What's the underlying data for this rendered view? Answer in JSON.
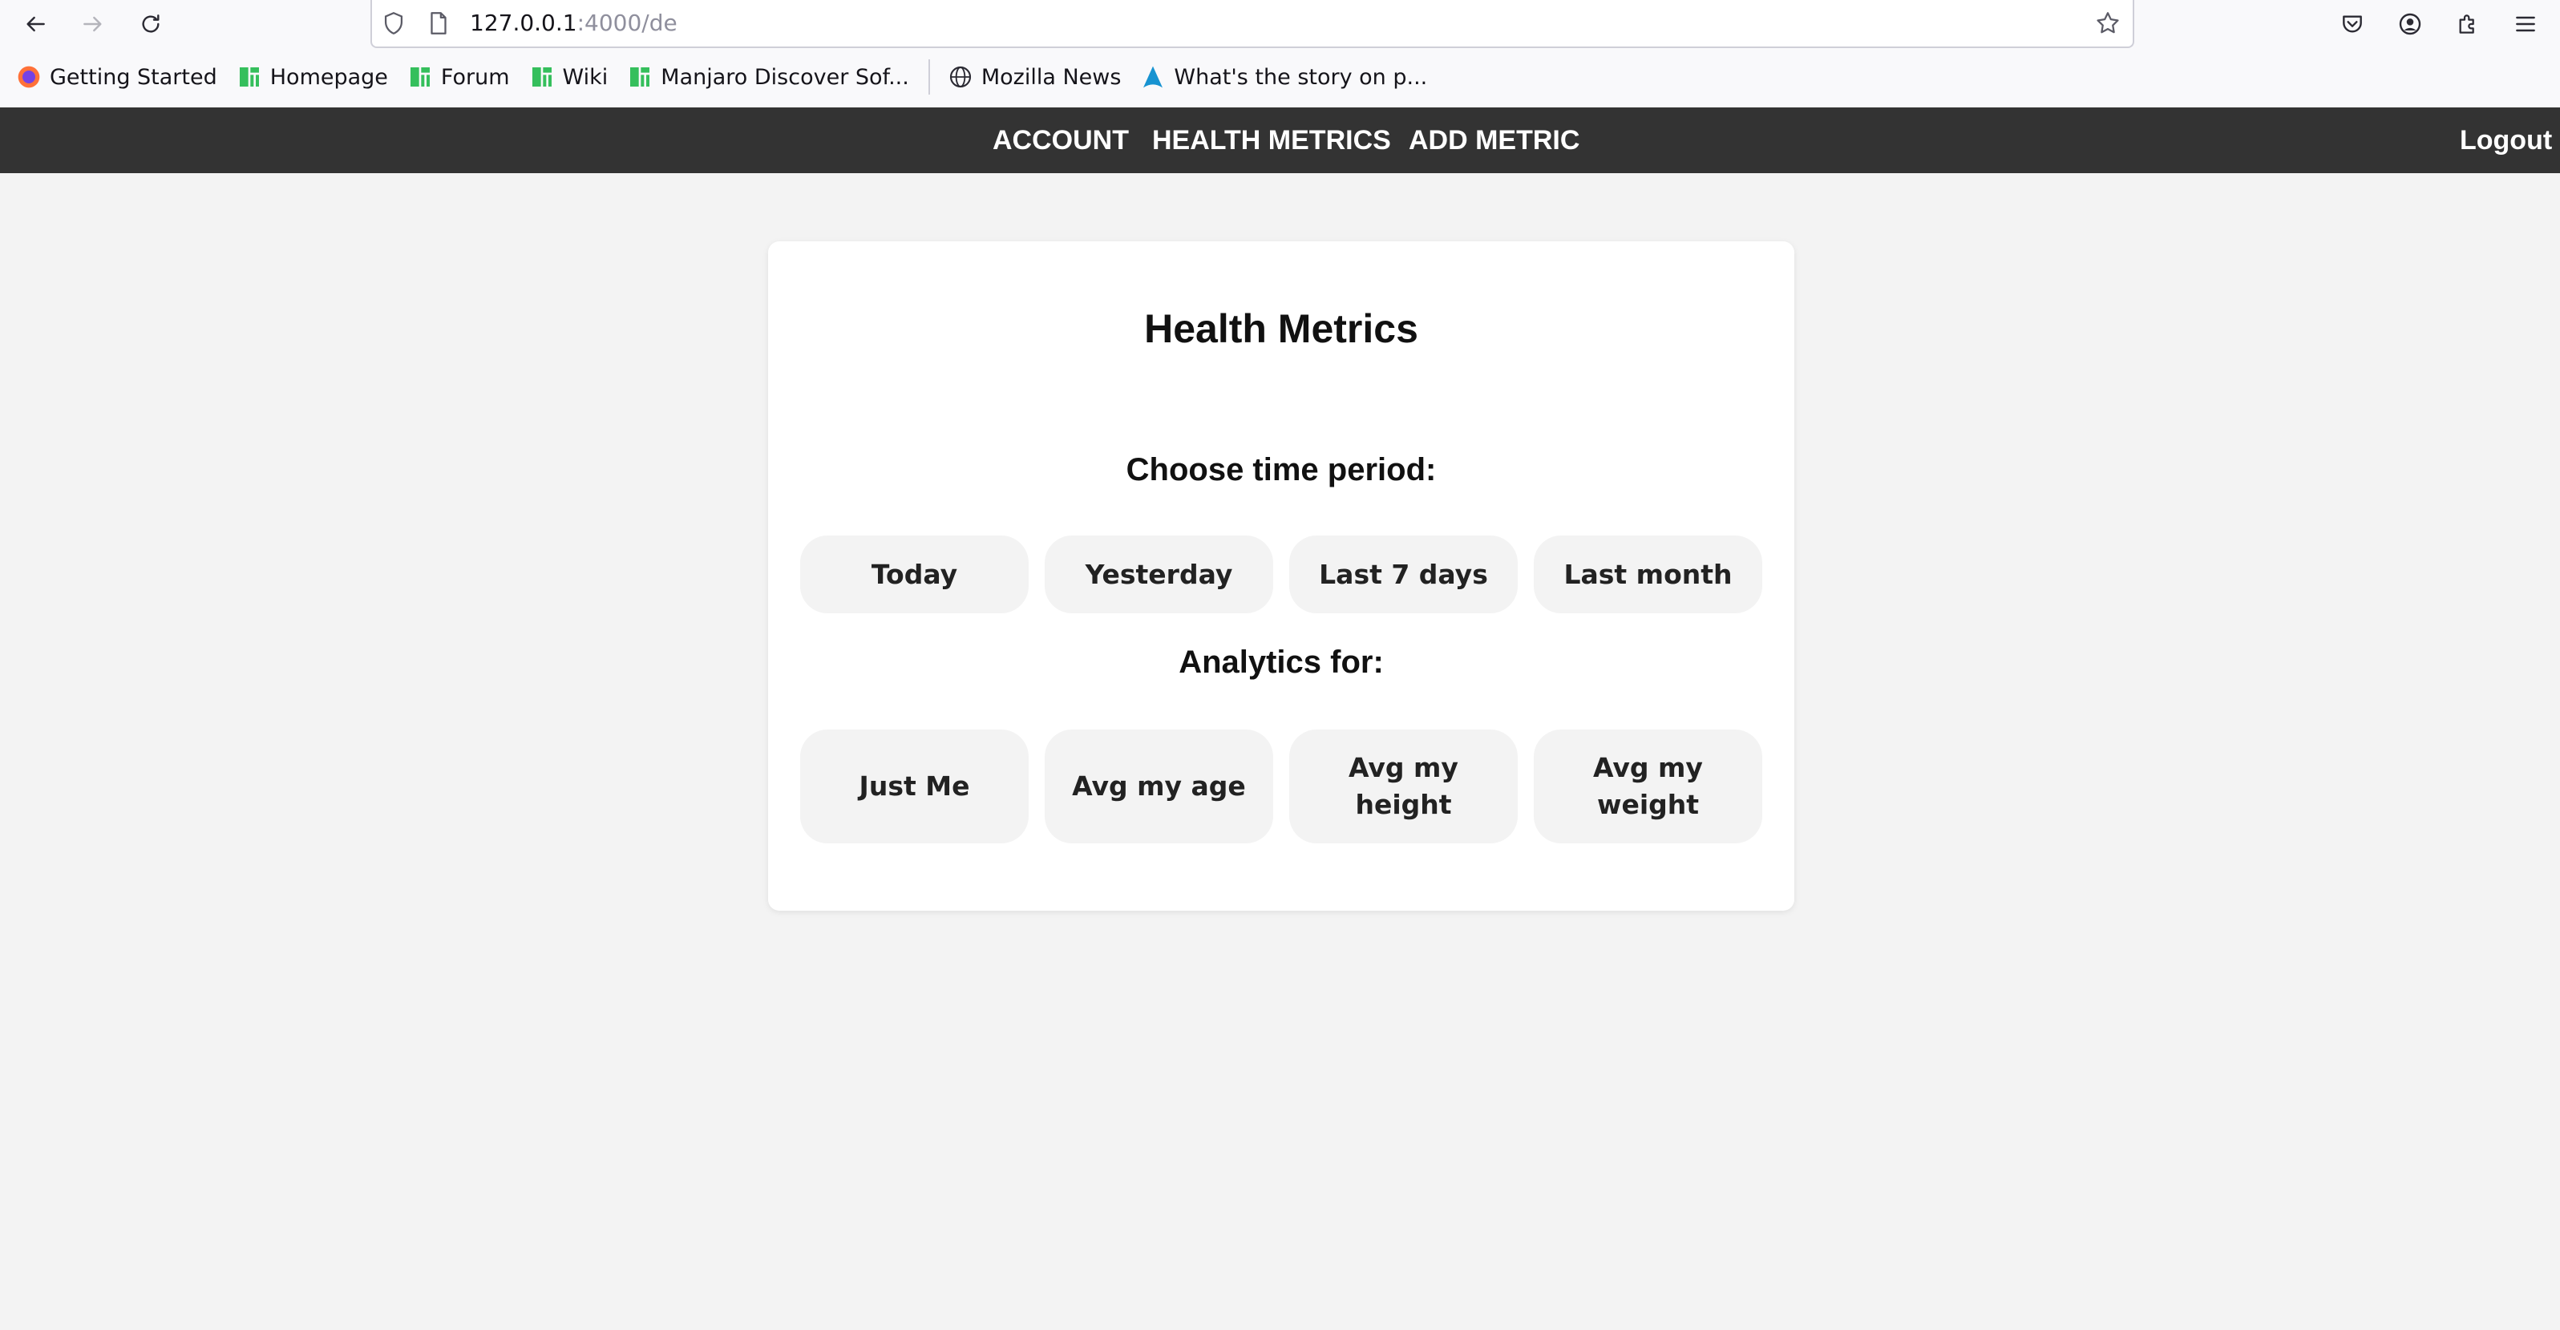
{
  "browser": {
    "url_host": "127.0.0.1",
    "url_path": ":4000/de",
    "bookmarks": [
      {
        "label": "Getting Started",
        "icon": "firefox-icon"
      },
      {
        "label": "Homepage",
        "icon": "manjaro-icon"
      },
      {
        "label": "Forum",
        "icon": "manjaro-icon"
      },
      {
        "label": "Wiki",
        "icon": "manjaro-icon"
      },
      {
        "label": "Manjaro Discover Sof...",
        "icon": "manjaro-icon"
      },
      {
        "label": "Mozilla News",
        "icon": "globe-icon"
      },
      {
        "label": "What's the story on p...",
        "icon": "arch-icon"
      }
    ]
  },
  "nav": {
    "account": "ACCOUNT",
    "health_metrics": "HEALTH METRICS",
    "add_metric": "ADD METRIC",
    "logout": "Logout"
  },
  "card": {
    "title": "Health Metrics",
    "period_heading": "Choose time period:",
    "periods": [
      "Today",
      "Yesterday",
      "Last 7 days",
      "Last month"
    ],
    "analytics_heading": "Analytics for:",
    "analytics": [
      "Just Me",
      "Avg my age",
      "Avg my height",
      "Avg my weight"
    ]
  },
  "colors": {
    "nav_bg": "#333333",
    "page_bg": "#f3f3f3",
    "card_bg": "#ffffff",
    "pill_bg": "#f3f3f3",
    "manjaro_green": "#35bf5c"
  }
}
